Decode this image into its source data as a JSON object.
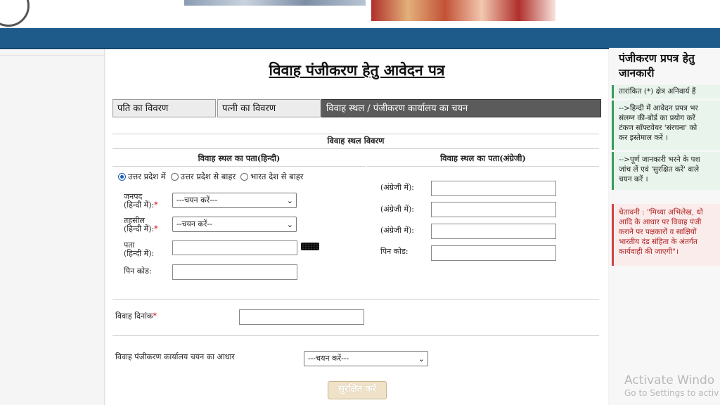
{
  "form": {
    "title": "विवाह पंजीकरण हेतु आवेदन पत्र",
    "tabs": [
      {
        "label": "पति का विवरण",
        "active": false
      },
      {
        "label": "पत्नी का विवरण",
        "active": false
      },
      {
        "label": "विवाह स्थल / पंजीकरण कार्यालय का चयन",
        "active": true
      }
    ],
    "section_title": "विवाह स्थल विवरण",
    "hindi_address": {
      "heading": "विवाह स्थल का पता(हिन्दी)",
      "radio_options": [
        {
          "label": "उत्तर प्रदेश में",
          "checked": true
        },
        {
          "label": "उत्तर प्रदेश से बाहर",
          "checked": false
        },
        {
          "label": "भारत देश से बाहर",
          "checked": false
        }
      ],
      "district_label": "जनपद",
      "district_sublabel": "(हिन्दी में):",
      "district_select": "---चयन करें---",
      "tehsil_label": "तहसील",
      "tehsil_sublabel": "(हिन्दी में):",
      "tehsil_select": "--चयन करें--",
      "address_label": "पता",
      "address_sublabel": "(हिन्दी में):",
      "address_value": "",
      "pincode_label": "पिन कोड:",
      "pincode_value": ""
    },
    "english_address": {
      "heading": "विवाह स्थल का पता(अंग्रेजी)",
      "field1_label": "(अंग्रेजी में):",
      "field2_label": "(अंग्रेजी में):",
      "field3_label": "(अंग्रेजी में):",
      "pincode_label": "पिन कोड:",
      "field1_value": "",
      "field2_value": "",
      "field3_value": "",
      "pincode_value": ""
    },
    "marriage_date_label": "विवाह दिनांक",
    "marriage_date_value": "",
    "office_basis_label": "विवाह पंजीकरण कार्यालय चयन का आधार",
    "office_basis_select": "---चयन करें---",
    "save_label": "सुरक्षित करें",
    "required_mark": "*"
  },
  "sidebar": {
    "title_line1": "पंजीकरण प्रपत्र हेतु",
    "title_line2": "जानकारी",
    "info1": "तारांकित (*) क्षेत्र अनिवार्य हैं",
    "info2_line1": "-->हिन्दी में आवेदन प्रपत्र भर",
    "info2_line2": "संलग्न की-बोर्ड का प्रयोग करें",
    "info2_line3": "टंकण सॉफ्टवेयर 'संरचना' को",
    "info2_line4": "कर इस्तेमाल करें ।",
    "info3_line1": "-->पूर्ण जानकारी भरने के पश",
    "info3_line2": "जांच लें एवं 'सुरक्षित करें' वाले",
    "info3_line3": "चयन करें ।",
    "warning_line1": "चेतावनी : \"मिथ्या अभिलेख, धो",
    "warning_line2": "आदि के आधार पर विवाह पंजी",
    "warning_line3": "कराने पर पक्षकारों व साक्षियों",
    "warning_line4": "भारतीय दंड संहिता के अंतर्गत",
    "warning_line5": "कार्यवाही की जाएगी\"।"
  },
  "watermark": {
    "line1": "Activate Windo",
    "line2": "Go to Settings to activ"
  }
}
